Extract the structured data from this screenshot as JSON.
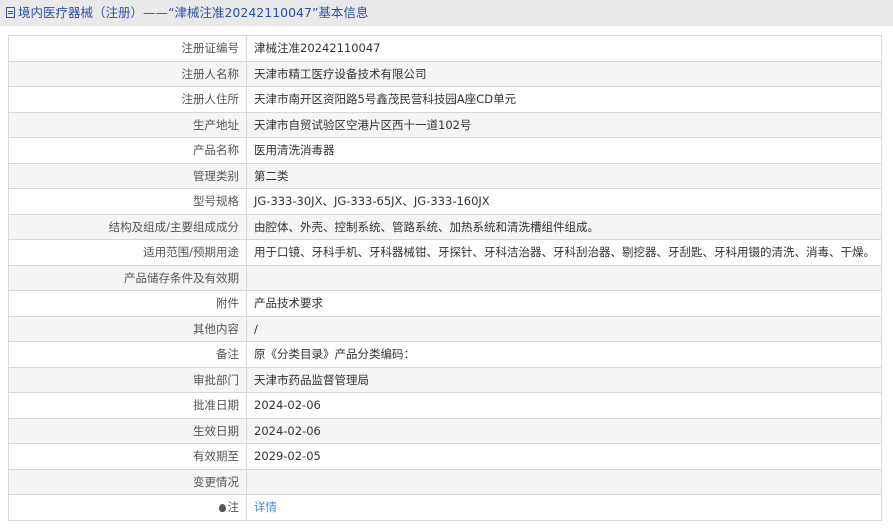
{
  "header": {
    "icon": "document-icon",
    "title": "境内医疗器械（注册）——“津械注准20242110047”基本信息"
  },
  "rows": [
    {
      "label": "注册证编号",
      "value": "津械注准20242110047"
    },
    {
      "label": "注册人名称",
      "value": "天津市精工医疗设备技术有限公司"
    },
    {
      "label": "注册人住所",
      "value": "天津市南开区资阳路5号鑫茂民营科技园A座CD单元"
    },
    {
      "label": "生产地址",
      "value": "天津市自贸试验区空港片区西十一道102号"
    },
    {
      "label": "产品名称",
      "value": "医用清洗消毒器"
    },
    {
      "label": "管理类别",
      "value": "第二类"
    },
    {
      "label": "型号规格",
      "value": "JG-333-30JX、JG-333-65JX、JG-333-160JX"
    },
    {
      "label": "结构及组成/主要组成成分",
      "value": "由腔体、外壳、控制系统、管路系统、加热系统和清洗槽组件组成。"
    },
    {
      "label": "适用范围/预期用途",
      "value": "用于口镜、牙科手机、牙科器械钳、牙探针、牙科洁治器、牙科刮治器、剔挖器、牙刮匙、牙科用镊的清洗、消毒、干燥。"
    },
    {
      "label": "产品储存条件及有效期",
      "value": ""
    },
    {
      "label": "附件",
      "value": "产品技术要求"
    },
    {
      "label": "其他内容",
      "value": "/"
    },
    {
      "label": "备注",
      "value": "原《分类目录》产品分类编码："
    },
    {
      "label": "审批部门",
      "value": "天津市药品监督管理局"
    },
    {
      "label": "批准日期",
      "value": "2024-02-06"
    },
    {
      "label": "生效日期",
      "value": "2024-02-06"
    },
    {
      "label": "有效期至",
      "value": "2029-02-05"
    },
    {
      "label": "变更情况",
      "value": ""
    }
  ],
  "note": {
    "icon": "pin-icon",
    "label": "注",
    "link": "详情"
  }
}
